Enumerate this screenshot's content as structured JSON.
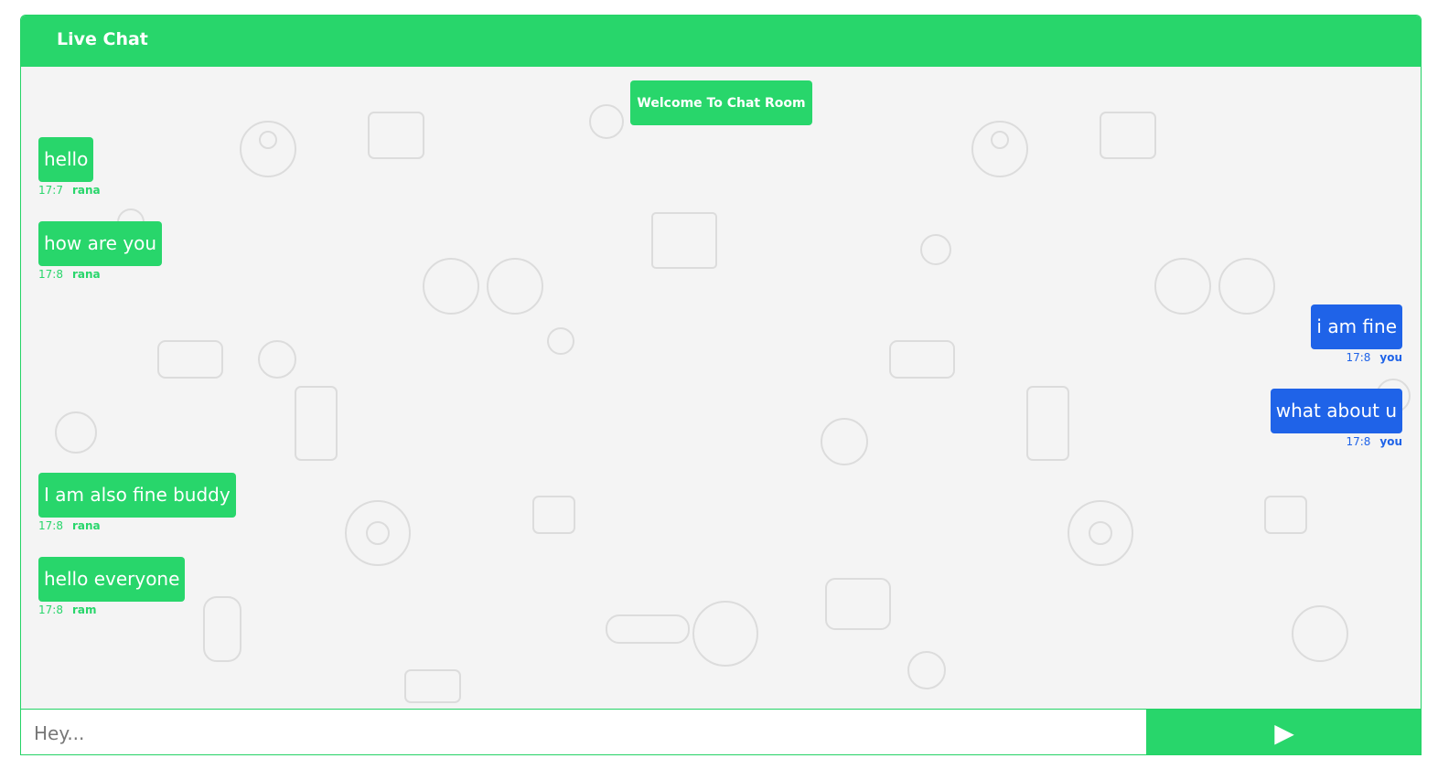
{
  "header": {
    "title": "Live Chat"
  },
  "welcome": {
    "text": "Welcome To Chat Room"
  },
  "messages": [
    {
      "direction": "incoming",
      "text": "hello",
      "time": "17:7",
      "sender": "rana"
    },
    {
      "direction": "incoming",
      "text": "how are you",
      "time": "17:8",
      "sender": "rana"
    },
    {
      "direction": "outgoing",
      "text": "i am fine",
      "time": "17:8",
      "sender": "you"
    },
    {
      "direction": "outgoing",
      "text": "what about u",
      "time": "17:8",
      "sender": "you"
    },
    {
      "direction": "incoming",
      "text": "I am also fine buddy",
      "time": "17:8",
      "sender": "rana"
    },
    {
      "direction": "incoming",
      "text": "hello everyone",
      "time": "17:8",
      "sender": "ram"
    }
  ],
  "composer": {
    "placeholder": "Hey...",
    "value": "",
    "send_icon": "play-triangle-icon",
    "send_glyph": "▶"
  },
  "colors": {
    "accent": "#28d66b",
    "outgoing": "#1f63e8",
    "background": "#f4f4f4"
  }
}
